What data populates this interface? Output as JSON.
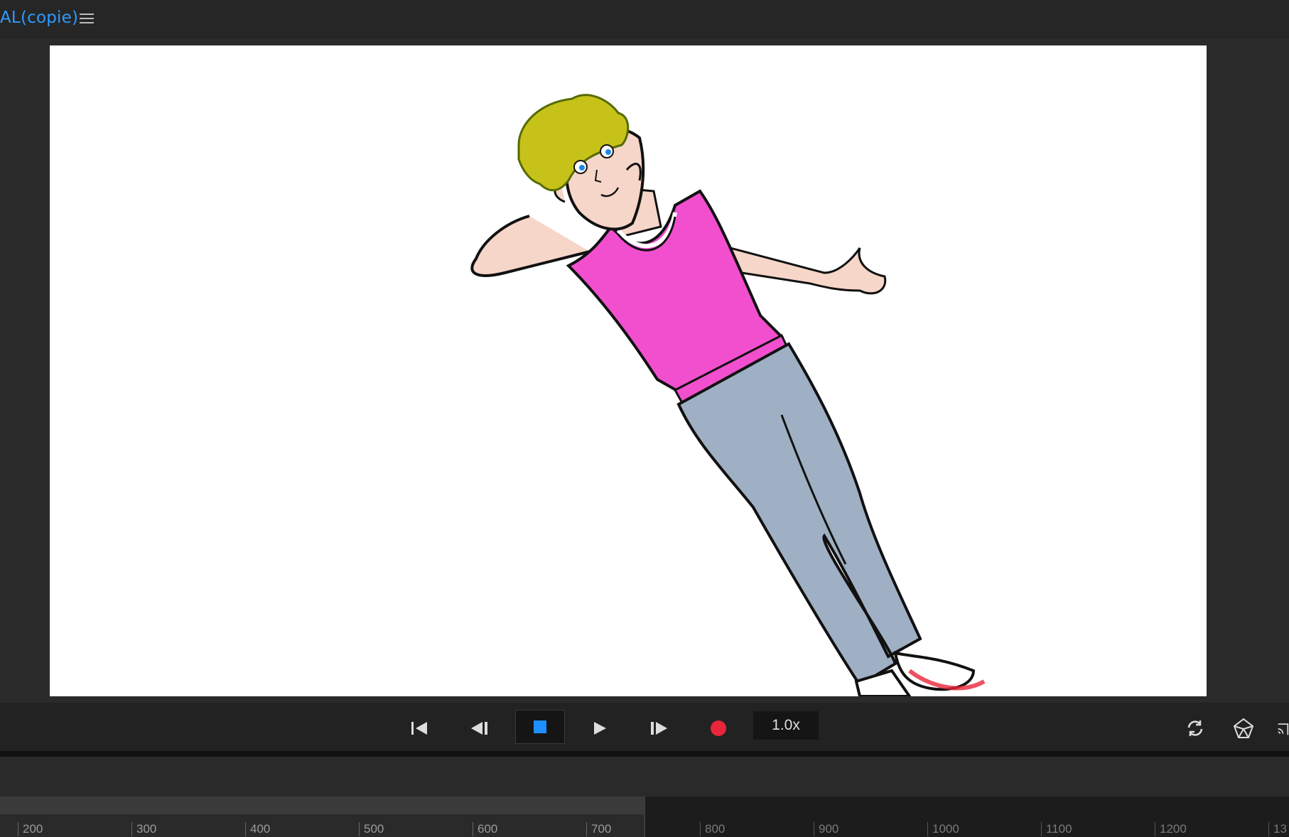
{
  "header": {
    "title": "AL(copie)",
    "menu_icon": "hamburger-menu-icon"
  },
  "transport": {
    "buttons": [
      "skip-to-start-icon",
      "step-back-icon",
      "stop-icon",
      "play-icon",
      "step-forward-icon",
      "record-icon"
    ],
    "speed": "1.0x",
    "accent": "#1e90ff",
    "record_color": "#e8253a",
    "right_icons": [
      "loop-icon",
      "cube-icon"
    ]
  },
  "timeline": {
    "ticks": [
      "200",
      "300",
      "400",
      "500",
      "600",
      "700",
      "800",
      "900",
      "1000",
      "1100",
      "1200",
      "13"
    ]
  }
}
